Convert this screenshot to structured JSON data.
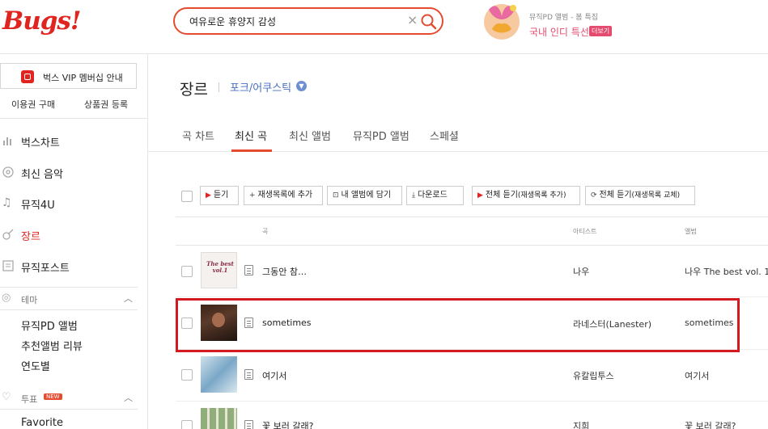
{
  "header": {
    "logo": "Bugs!",
    "search_value": "여유로운 휴양지 감성",
    "search_clear": "×",
    "promo_subtitle": "뮤직PD 앨범 - 봄 특집",
    "promo_title": "국내 인디 특선",
    "promo_badge": "더보기"
  },
  "sidebar": {
    "vip_label": "벅스 VIP 멤버십 안내",
    "buy_pass": "이용권 구매",
    "gift_register": "상품권 등록",
    "nav": [
      {
        "label": "벅스차트",
        "icon": "chart-icon"
      },
      {
        "label": "최신 음악",
        "icon": "disc-icon"
      },
      {
        "label": "뮤직4U",
        "icon": "note-icon"
      },
      {
        "label": "장르",
        "icon": "guitar-icon",
        "active": true
      },
      {
        "label": "뮤직포스트",
        "icon": "post-icon"
      }
    ],
    "theme_section": "테마",
    "theme_items": [
      "뮤직PD 앨범",
      "추천앨범 리뷰",
      "연도별"
    ],
    "vote_section": "투표",
    "new_badge": "NEW",
    "vote_items": [
      "Favorite"
    ]
  },
  "main": {
    "title": "장르",
    "genre": "포크/어쿠스틱",
    "tabs": [
      "곡 차트",
      "최신 곡",
      "최신 앨범",
      "뮤직PD 앨범",
      "스페셜"
    ],
    "toolbar": {
      "play": "듣기",
      "add_playlist": "재생목록에 추가",
      "add_album": "내 앨범에 담기",
      "download": "다운로드",
      "play_all_add": "전체 듣기",
      "play_all_add_note": "(재생목록 추가)",
      "play_all_replace": "전체 듣기",
      "play_all_replace_note": "(재생목록 교체)"
    },
    "columns": {
      "song": "곡",
      "artist": "아티스트",
      "album": "앨범"
    },
    "rows": [
      {
        "title": "그동안 참…",
        "artist": "나우",
        "album": "나우 The best vol. 1",
        "thumb_text": "The best vol.1"
      },
      {
        "title": "sometimes",
        "artist": "라네스터(Lanester)",
        "album": "sometimes"
      },
      {
        "title": "여기서",
        "artist": "유칼립투스",
        "album": "여기서"
      },
      {
        "title": "꽃 보러 갈래?",
        "artist": "지희",
        "album": "꽃 보러 갈래?"
      }
    ]
  },
  "colors": {
    "brand": "#e0241f",
    "accent": "#e44b2f",
    "link": "#4a6fc0",
    "highlight_box": "#d21a20"
  }
}
